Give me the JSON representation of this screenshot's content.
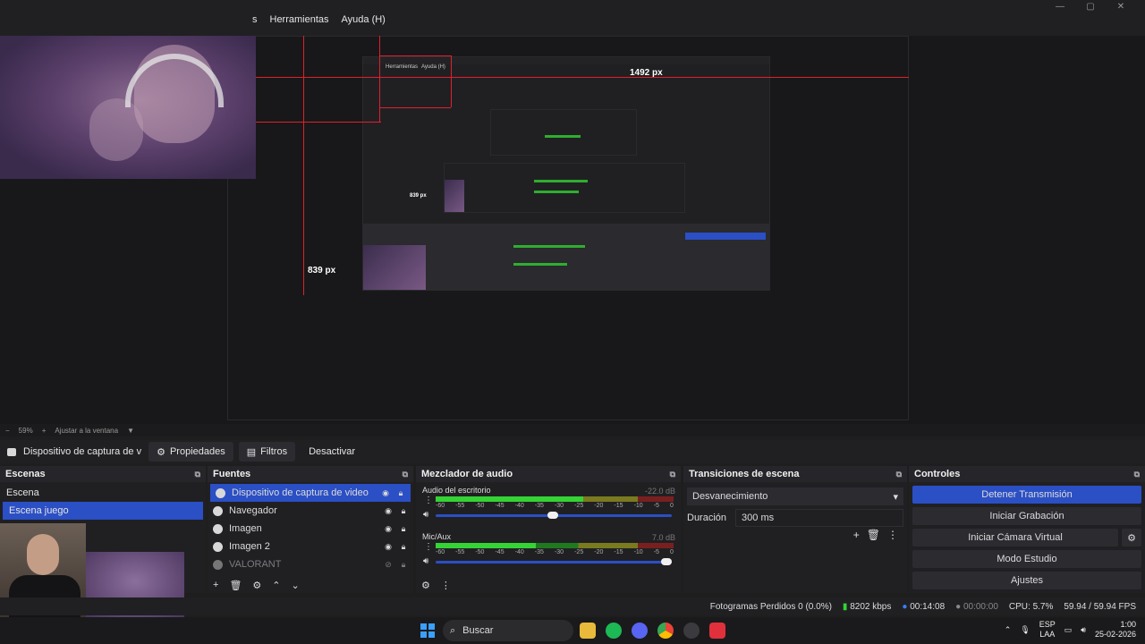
{
  "menu": {
    "items": [
      "s",
      "Herramientas",
      "Ayuda (H)"
    ]
  },
  "window_controls": [
    "—",
    "▢",
    "✕"
  ],
  "preview": {
    "measure_width": "1492 px",
    "measure_height": "839 px",
    "measure_height_small": "839 px",
    "nested_menu": [
      "Herramientas",
      "Ayuda (H)"
    ]
  },
  "zoombar": {
    "minus": "−",
    "zoom": "59%",
    "plus": "+",
    "fit": "Ajustar a la ventana",
    "caret": "▼"
  },
  "context": {
    "source_name": "Dispositivo de captura de v",
    "properties": "Propiedades",
    "filters": "Filtros",
    "deactivate": "Desactivar"
  },
  "scenes": {
    "title": "Escenas",
    "items": [
      {
        "label": "Escena",
        "active": false
      },
      {
        "label": "Escena juego",
        "active": true
      }
    ]
  },
  "sources": {
    "title": "Fuentes",
    "items": [
      {
        "label": "Dispositivo de captura de video",
        "active": true,
        "icon": "camera-icon"
      },
      {
        "label": "Navegador",
        "active": false,
        "icon": "globe-icon"
      },
      {
        "label": "Imagen",
        "active": false,
        "icon": "image-icon"
      },
      {
        "label": "Imagen 2",
        "active": false,
        "icon": "image-icon"
      },
      {
        "label": "VALORANT",
        "active": false,
        "icon": "game-capture-icon",
        "hidden": true
      }
    ]
  },
  "mixer": {
    "title": "Mezclador de audio",
    "channels": [
      {
        "name": "Audio del escritorio",
        "db": "-22.0 dB",
        "level": 0.62,
        "volume": 0.52
      },
      {
        "name": "Mic/Aux",
        "db": "7.0 dB",
        "level": 0.42,
        "volume": 1.0
      }
    ],
    "ticks": [
      "-60",
      "-55",
      "-50",
      "-45",
      "-40",
      "-35",
      "-30",
      "-25",
      "-20",
      "-15",
      "-10",
      "-5",
      "0"
    ]
  },
  "transitions": {
    "title": "Transiciones de escena",
    "selected": "Desvanecimiento",
    "duration_label": "Duración",
    "duration_value": "300 ms"
  },
  "controls": {
    "title": "Controles",
    "stop_stream": "Detener Transmisión",
    "start_recording": "Iniciar Grabación",
    "start_virtual_cam": "Iniciar Cámara Virtual",
    "studio_mode": "Modo Estudio",
    "settings": "Ajustes"
  },
  "status": {
    "dropped_frames": "Fotogramas Perdidos 0 (0.0%)",
    "bitrate": "8202 kbps",
    "stream_time": "00:14:08",
    "rec_time": "00:00:00",
    "cpu": "CPU: 5.7%",
    "fps": "59.94 / 59.94 FPS"
  },
  "taskbar": {
    "search": "Buscar",
    "lang_top": "ESP",
    "lang_bottom": "LAA",
    "time": "1:00",
    "date": "25-02-2026"
  },
  "colors": {
    "accent": "#2b4fc4",
    "measure_line": "#e0202a",
    "meter_green": "#35d335"
  }
}
